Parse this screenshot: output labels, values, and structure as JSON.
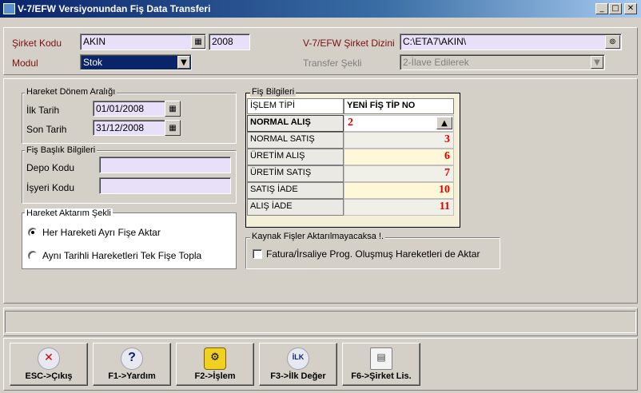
{
  "window": {
    "title": "V-7/EFW Versiyonundan Fiş Data Transferi",
    "min": "_",
    "max": "□",
    "close": "✕"
  },
  "header": {
    "sirket_kodu_label": "Şirket Kodu",
    "sirket_kodu_value": "AKIN",
    "year_value": "2008",
    "modul_label": "Modul",
    "modul_value": "Stok",
    "dizin_label": "V-7/EFW Şirket Dizini",
    "dizin_value": "C:\\ETA7\\AKIN\\",
    "transfer_label": "Transfer Şekli",
    "transfer_value": "2-İlave Edilerek"
  },
  "donem": {
    "title": "Hareket Dönem Aralığı",
    "ilk_label": "İlk Tarih",
    "ilk_value": "01/01/2008",
    "son_label": "Son Tarih",
    "son_value": "31/12/2008"
  },
  "baslik": {
    "title": "Fiş Başlık Bilgileri",
    "depo_label": "Depo Kodu",
    "isyeri_label": "İşyeri Kodu"
  },
  "aktarim": {
    "title": "Hareket Aktarım Şekli",
    "opt1": "Her Hareketi Ayrı Fişe Aktar",
    "opt2": "Aynı Tarihli Hareketleri Tek Fişe Topla",
    "selected": 1
  },
  "fis": {
    "title": "Fiş Bilgileri",
    "col1": "İŞLEM TİPİ",
    "col2": "YENİ FİŞ TİP NO",
    "rows": [
      {
        "tip": "NORMAL ALIŞ",
        "no": "2"
      },
      {
        "tip": "NORMAL SATIŞ",
        "no": "3"
      },
      {
        "tip": "ÜRETİM ALIŞ",
        "no": "6"
      },
      {
        "tip": "ÜRETİM SATIŞ",
        "no": "7"
      },
      {
        "tip": "SATIŞ İADE",
        "no": "10"
      },
      {
        "tip": "ALIŞ İADE",
        "no": "11"
      }
    ]
  },
  "kaynak": {
    "title": "Kaynak Fişler Aktarılmayacaksa  !.",
    "check_label": "Fatura/İrsaliye  Prog. Oluşmuş Hareketleri de Aktar",
    "checked": false
  },
  "buttons": [
    {
      "label": "ESC->Çıkış",
      "icon": "exit-icon"
    },
    {
      "label": "F1->Yardım",
      "icon": "help-icon"
    },
    {
      "label": "F2->İşlem",
      "icon": "process-icon"
    },
    {
      "label": "F3->İlk Değer",
      "icon": "ilk-icon",
      "icon_text": "İLK"
    },
    {
      "label": "F6->Şirket Lis.",
      "icon": "company-list-icon"
    }
  ],
  "colors": {
    "field_bg": "#e8e0f8",
    "accent_red": "#e00000",
    "title_blue": "#0a246a"
  }
}
